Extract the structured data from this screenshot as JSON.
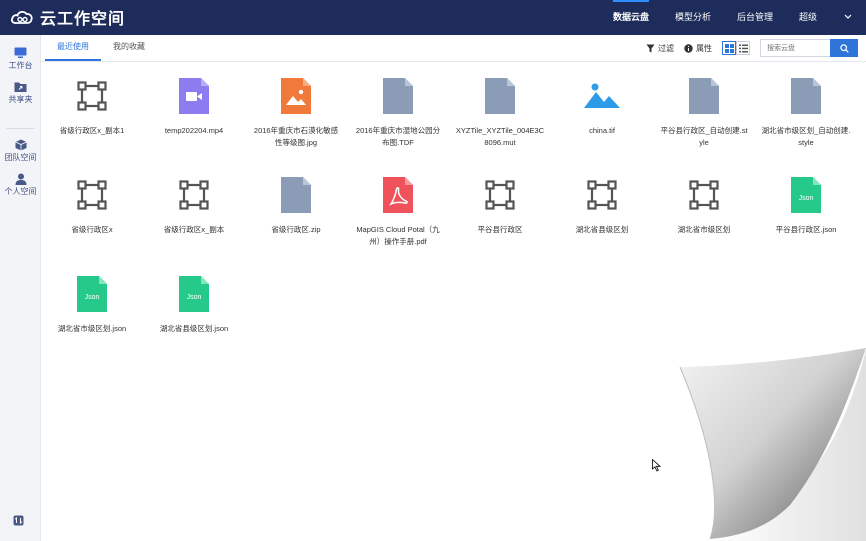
{
  "app": {
    "logo_text": "云工作空间"
  },
  "nav": {
    "items": [
      {
        "label": "数据云盘",
        "active": true
      },
      {
        "label": "模型分析",
        "active": false
      },
      {
        "label": "后台管理",
        "active": false
      },
      {
        "label": "超级",
        "active": false
      }
    ]
  },
  "sidebar": {
    "items": [
      {
        "label": "工作台",
        "icon": "monitor-icon"
      },
      {
        "label": "共享夹",
        "icon": "share-folder-icon"
      },
      {
        "label": "团队空间",
        "icon": "team-cube-icon"
      },
      {
        "label": "个人空间",
        "icon": "user-icon"
      }
    ]
  },
  "tabs": [
    {
      "label": "最近使用",
      "active": true
    },
    {
      "label": "我的收藏",
      "active": false
    }
  ],
  "toolbar": {
    "filter_label": "过滤",
    "attr_label": "属性",
    "search_placeholder": "搜索云盘"
  },
  "files": [
    {
      "name": "省级行政区x_副本1",
      "type": "feature"
    },
    {
      "name": "temp202204.mp4",
      "type": "video"
    },
    {
      "name": "2016年重庆市石漠化敏感性等级图.jpg",
      "type": "image-orange"
    },
    {
      "name": "2016年重庆市湿地公园分布图.TDF",
      "type": "doc"
    },
    {
      "name": "XYZTile_XYZTile_004E3C8096.mut",
      "type": "doc"
    },
    {
      "name": "china.tif",
      "type": "image-blue"
    },
    {
      "name": "平谷县行政区_自动创建.style",
      "type": "doc"
    },
    {
      "name": "湖北省市级区划_自动创建.style",
      "type": "doc"
    },
    {
      "name": "省级行政区x",
      "type": "feature"
    },
    {
      "name": "省级行政区x_副本",
      "type": "feature"
    },
    {
      "name": "省级行政区.zip",
      "type": "doc"
    },
    {
      "name": "MapGIS Cloud Potal（九州）操作手册.pdf",
      "type": "pdf"
    },
    {
      "name": "平谷县行政区",
      "type": "feature"
    },
    {
      "name": "湖北省县级区划",
      "type": "feature"
    },
    {
      "name": "湖北省市级区划",
      "type": "feature"
    },
    {
      "name": "平谷县行政区.json",
      "type": "json"
    },
    {
      "name": "湖北省市级区划.json",
      "type": "json"
    },
    {
      "name": "湖北省县级区划.json",
      "type": "json"
    }
  ],
  "colors": {
    "nav_bg": "#1d2c5a",
    "accent": "#2f74d8",
    "doc_gray": "#8a9cb6",
    "video_purple": "#8b7cf0",
    "image_orange": "#f07a3c",
    "image_blue": "#2e9be8",
    "pdf_red": "#f0525b",
    "json_green": "#25c98a"
  }
}
